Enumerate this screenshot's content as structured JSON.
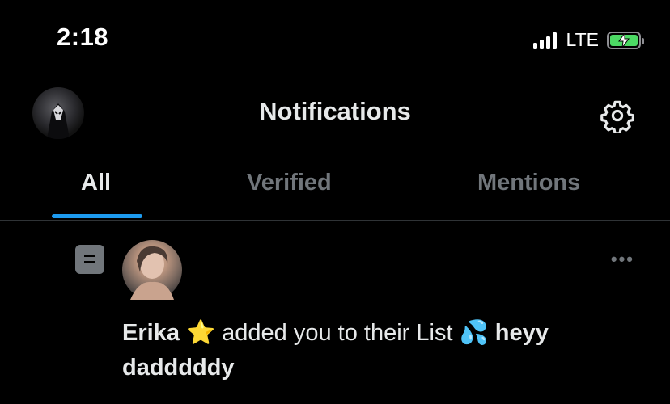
{
  "status_bar": {
    "time": "2:18",
    "network": "LTE",
    "battery_color": "#4cd964"
  },
  "header": {
    "title": "Notifications",
    "profile_icon": "avatar",
    "settings_icon": "gear-icon"
  },
  "tabs": [
    {
      "label": "All",
      "active": true
    },
    {
      "label": "Verified",
      "active": false
    },
    {
      "label": "Mentions",
      "active": false
    }
  ],
  "accent_color": "#1d9bf0",
  "notification": {
    "type_icon": "list-icon",
    "user_name": "Erika ⭐",
    "action": "added you to their List",
    "list_name": "💦 heyy dadddddy",
    "more_icon": "more-dots-icon",
    "more_label": "•••"
  }
}
